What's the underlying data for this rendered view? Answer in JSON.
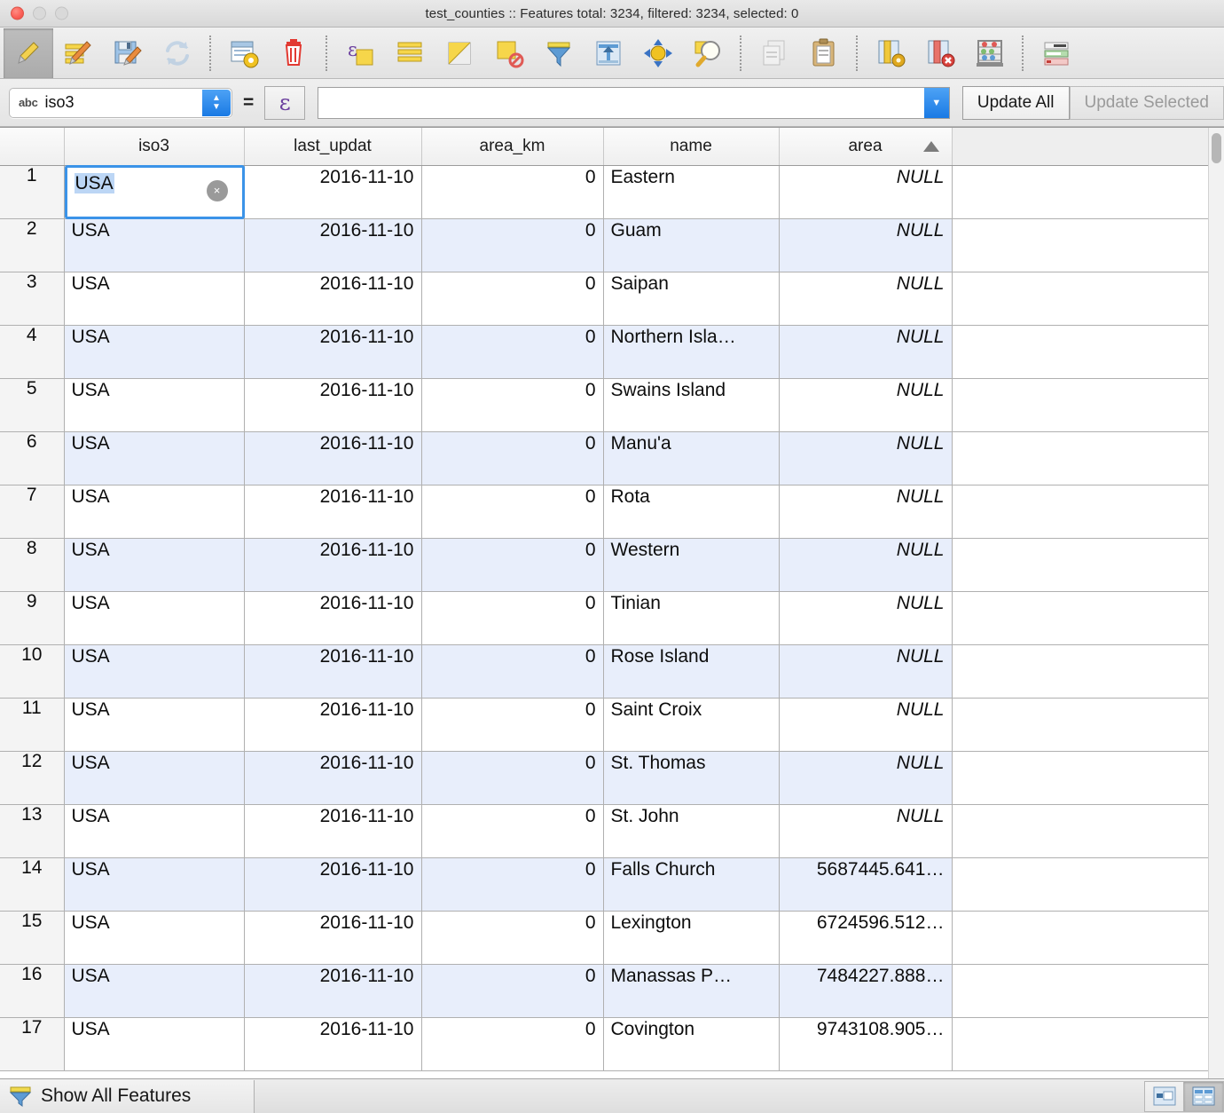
{
  "window": {
    "title": "test_counties :: Features total: 3234, filtered: 3234, selected: 0",
    "traffic_lights": [
      "close",
      "minimize",
      "maximize"
    ]
  },
  "toolbar": {
    "buttons": [
      {
        "name": "toggle-editing-icon",
        "label": "Toggle editing mode",
        "state": "pressed"
      },
      {
        "name": "edit-multiple-icon",
        "label": "Multi edit attributes",
        "state": "normal"
      },
      {
        "name": "save-edits-icon",
        "label": "Save edits",
        "state": "normal"
      },
      {
        "name": "reload-table-icon",
        "label": "Reload the table",
        "state": "disabled"
      },
      {
        "name": "add-feature-icon",
        "label": "Add feature",
        "state": "normal"
      },
      {
        "name": "delete-selected-icon",
        "label": "Delete selected features",
        "state": "normal"
      },
      {
        "name": "select-by-expression-icon",
        "label": "Select features using an expression",
        "state": "normal"
      },
      {
        "name": "select-all-icon",
        "label": "Select all",
        "state": "normal"
      },
      {
        "name": "invert-selection-icon",
        "label": "Invert selection",
        "state": "normal"
      },
      {
        "name": "deselect-all-icon",
        "label": "Deselect all",
        "state": "normal"
      },
      {
        "name": "filter-icon",
        "label": "Filter / select using form",
        "state": "normal"
      },
      {
        "name": "move-selection-to-top-icon",
        "label": "Move selection to top",
        "state": "normal"
      },
      {
        "name": "pan-to-selected-icon",
        "label": "Pan map to the selected rows",
        "state": "normal"
      },
      {
        "name": "zoom-to-selected-icon",
        "label": "Zoom map to the selected rows",
        "state": "normal"
      },
      {
        "name": "copy-rows-icon",
        "label": "Copy selected rows to clipboard",
        "state": "disabled"
      },
      {
        "name": "paste-features-icon",
        "label": "Paste features from clipboard",
        "state": "normal"
      },
      {
        "name": "new-column-icon",
        "label": "New field",
        "state": "normal"
      },
      {
        "name": "delete-column-icon",
        "label": "Delete field",
        "state": "normal"
      },
      {
        "name": "field-calculator-icon",
        "label": "Open field calculator",
        "state": "normal"
      },
      {
        "name": "conditional-formatting-icon",
        "label": "Conditional formatting",
        "state": "normal"
      }
    ]
  },
  "expression_bar": {
    "field_type_badge": "abc",
    "field_name": "iso3",
    "equals": "=",
    "expression_button": "ε",
    "value": "",
    "value_placeholder": "",
    "update_all_label": "Update All",
    "update_selected_label": "Update Selected",
    "update_selected_enabled": false
  },
  "table": {
    "columns": [
      {
        "key": "rownum",
        "label": "",
        "align": "center"
      },
      {
        "key": "iso3",
        "label": "iso3",
        "align": "left"
      },
      {
        "key": "last_updat",
        "label": "last_updat",
        "align": "right"
      },
      {
        "key": "area_km",
        "label": "area_km",
        "align": "right"
      },
      {
        "key": "name",
        "label": "name",
        "align": "left"
      },
      {
        "key": "area",
        "label": "area",
        "align": "right",
        "sorted": "asc"
      }
    ],
    "sort_indicator": "▲",
    "editing_cell": {
      "row": 1,
      "column": "iso3",
      "value": "USA",
      "selected_text": true,
      "clear_button": "⌫"
    },
    "null_label": "NULL",
    "rows": [
      {
        "rownum": "1",
        "iso3": "USA",
        "last_updat": "2016-11-10",
        "area_km": "0",
        "name": "Eastern",
        "area": "NULL"
      },
      {
        "rownum": "2",
        "iso3": "USA",
        "last_updat": "2016-11-10",
        "area_km": "0",
        "name": "Guam",
        "area": "NULL"
      },
      {
        "rownum": "3",
        "iso3": "USA",
        "last_updat": "2016-11-10",
        "area_km": "0",
        "name": "Saipan",
        "area": "NULL"
      },
      {
        "rownum": "4",
        "iso3": "USA",
        "last_updat": "2016-11-10",
        "area_km": "0",
        "name": "Northern Isla…",
        "area": "NULL"
      },
      {
        "rownum": "5",
        "iso3": "USA",
        "last_updat": "2016-11-10",
        "area_km": "0",
        "name": "Swains Island",
        "area": "NULL"
      },
      {
        "rownum": "6",
        "iso3": "USA",
        "last_updat": "2016-11-10",
        "area_km": "0",
        "name": "Manu'a",
        "area": "NULL"
      },
      {
        "rownum": "7",
        "iso3": "USA",
        "last_updat": "2016-11-10",
        "area_km": "0",
        "name": "Rota",
        "area": "NULL"
      },
      {
        "rownum": "8",
        "iso3": "USA",
        "last_updat": "2016-11-10",
        "area_km": "0",
        "name": "Western",
        "area": "NULL"
      },
      {
        "rownum": "9",
        "iso3": "USA",
        "last_updat": "2016-11-10",
        "area_km": "0",
        "name": "Tinian",
        "area": "NULL"
      },
      {
        "rownum": "10",
        "iso3": "USA",
        "last_updat": "2016-11-10",
        "area_km": "0",
        "name": "Rose Island",
        "area": "NULL"
      },
      {
        "rownum": "11",
        "iso3": "USA",
        "last_updat": "2016-11-10",
        "area_km": "0",
        "name": "Saint Croix",
        "area": "NULL"
      },
      {
        "rownum": "12",
        "iso3": "USA",
        "last_updat": "2016-11-10",
        "area_km": "0",
        "name": "St. Thomas",
        "area": "NULL"
      },
      {
        "rownum": "13",
        "iso3": "USA",
        "last_updat": "2016-11-10",
        "area_km": "0",
        "name": "St. John",
        "area": "NULL"
      },
      {
        "rownum": "14",
        "iso3": "USA",
        "last_updat": "2016-11-10",
        "area_km": "0",
        "name": "Falls Church",
        "area": "5687445.641…"
      },
      {
        "rownum": "15",
        "iso3": "USA",
        "last_updat": "2016-11-10",
        "area_km": "0",
        "name": "Lexington",
        "area": "6724596.512…"
      },
      {
        "rownum": "16",
        "iso3": "USA",
        "last_updat": "2016-11-10",
        "area_km": "0",
        "name": "Manassas P…",
        "area": "7484227.888…"
      },
      {
        "rownum": "17",
        "iso3": "USA",
        "last_updat": "2016-11-10",
        "area_km": "0",
        "name": "Covington",
        "area": "9743108.905…"
      }
    ]
  },
  "status_bar": {
    "show_all_features_label": "Show All Features",
    "filter_icon": "funnel-icon",
    "view_buttons": [
      {
        "name": "form-view-button",
        "active": false
      },
      {
        "name": "table-view-button",
        "active": true
      }
    ]
  },
  "colors": {
    "alt_row": "#e8eefb",
    "selection_blue": "#3b93e8",
    "null_text": "#8c8c8c",
    "accent_blue": "#1a7ae4",
    "epsilon_purple": "#6b3f9e"
  }
}
